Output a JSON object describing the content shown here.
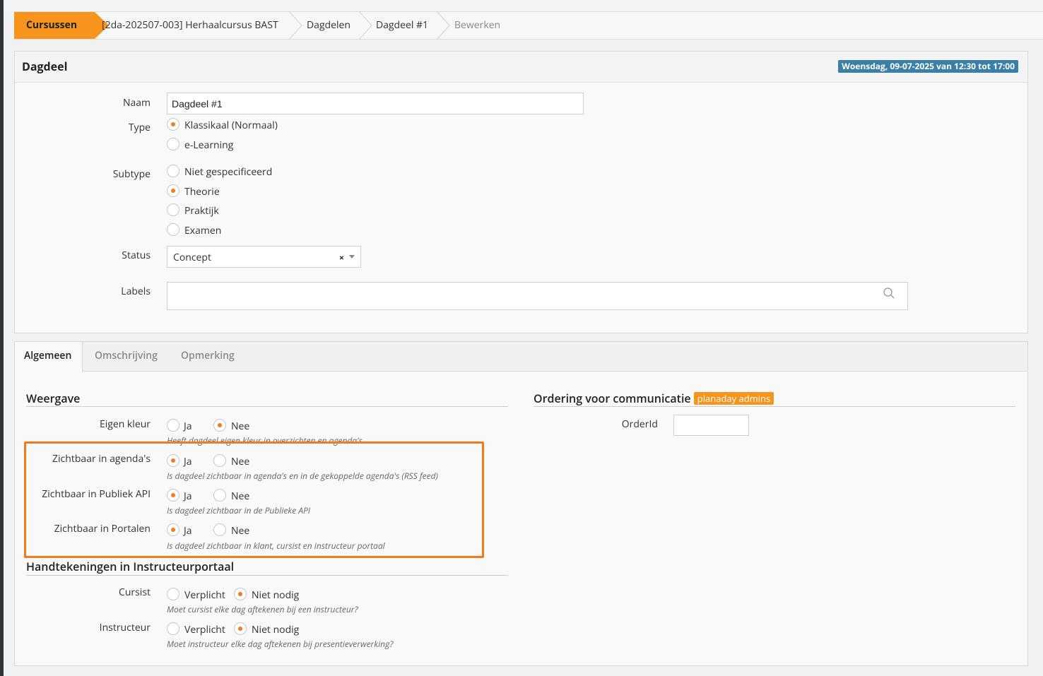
{
  "breadcrumb": {
    "items": [
      "Cursussen",
      "[2da-202507-003] Herhaalcursus BAST",
      "Dagdelen",
      "Dagdeel #1",
      "Bewerken"
    ]
  },
  "dagdeel": {
    "title": "Dagdeel",
    "date_badge": "Woensdag, 09-07-2025 van 12:30 tot 17:00",
    "naam_label": "Naam",
    "naam_value": "Dagdeel #1",
    "type_label": "Type",
    "type_options": [
      "Klassikaal (Normaal)",
      "e-Learning"
    ],
    "type_selected": "Klassikaal (Normaal)",
    "subtype_label": "Subtype",
    "subtype_options": [
      "Niet gespecificeerd",
      "Theorie",
      "Praktijk",
      "Examen"
    ],
    "subtype_selected": "Theorie",
    "status_label": "Status",
    "status_value": "Concept",
    "status_clear": "×",
    "labels_label": "Labels"
  },
  "tabs": [
    "Algemeen",
    "Omschrijving",
    "Opmerking"
  ],
  "active_tab": "Algemeen",
  "weergave": {
    "title": "Weergave",
    "yes": "Ja",
    "no": "Nee",
    "eigen_kleur": {
      "label": "Eigen kleur",
      "selected": "Nee",
      "hint": "Heeft dagdeel eigen kleur in overzichten en agenda's"
    },
    "agendas": {
      "label": "Zichtbaar in agenda's",
      "selected": "Ja",
      "hint": "Is dagdeel zichtbaar in agenda's en in de gekoppelde agenda's (RSS feed)"
    },
    "publiek_api": {
      "label": "Zichtbaar in Publiek API",
      "selected": "Ja",
      "hint": "Is dagdeel zichtbaar in de Publieke API"
    },
    "portalen": {
      "label": "Zichtbaar in Portalen",
      "selected": "Ja",
      "hint": "Is dagdeel zichtbaar in klant, cursist en instructeur portaal"
    }
  },
  "handtekeningen": {
    "title": "Handtekeningen in Instructeurportaal",
    "verplicht": "Verplicht",
    "niet_nodig": "Niet nodig",
    "cursist": {
      "label": "Cursist",
      "selected": "Niet nodig",
      "hint": "Moet cursist elke dag aftekenen bij een instructeur?"
    },
    "instructeur": {
      "label": "Instructeur",
      "selected": "Niet nodig",
      "hint": "Moet instructeur elke dag aftekenen bij presentieverwerking?"
    }
  },
  "ordering": {
    "title": "Ordering voor communicatie",
    "badge": "planaday admins",
    "orderid_label": "OrderId",
    "orderid_value": ""
  },
  "colors": {
    "accent": "#f7941d",
    "radio_dot": "#f47a1f",
    "badge_blue": "#3a7fa5"
  }
}
